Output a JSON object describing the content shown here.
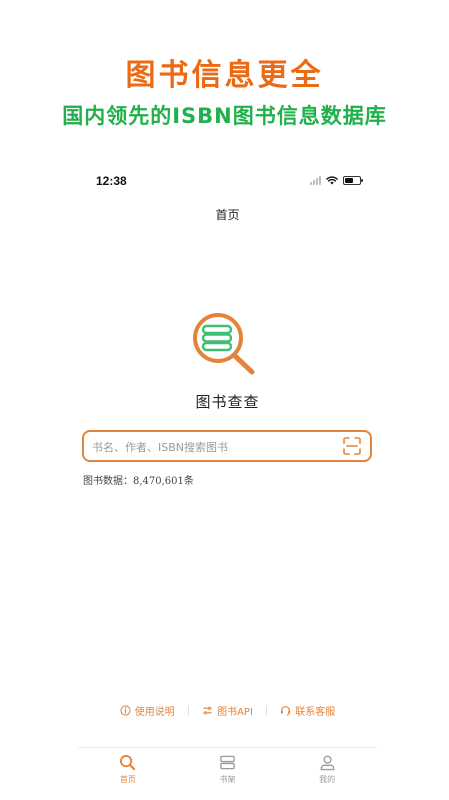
{
  "promo": {
    "title": "图书信息更全",
    "subtitle": "国内领先的ISBN图书信息数据库"
  },
  "status_bar": {
    "time": "12:38",
    "icons": [
      "signal-icon",
      "wifi-icon",
      "battery-icon"
    ]
  },
  "nav": {
    "title": "首页"
  },
  "app": {
    "name": "图书查查",
    "logo": "book-magnifier-icon"
  },
  "search": {
    "placeholder": "书名、作者、ISBN搜索图书",
    "scan_icon": "scan-icon"
  },
  "stats": {
    "label": "图书数据：",
    "count": "8,470,601条"
  },
  "footer_links": [
    {
      "label": "使用说明",
      "icon": "info-icon"
    },
    {
      "label": "图书API",
      "icon": "api-icon"
    },
    {
      "label": "联系客服",
      "icon": "headset-icon"
    }
  ],
  "footer_separator": "|",
  "tabs": [
    {
      "label": "首页",
      "icon": "search-icon",
      "active": true
    },
    {
      "label": "书架",
      "icon": "bookshelf-icon",
      "active": false
    },
    {
      "label": "我的",
      "icon": "user-icon",
      "active": false
    }
  ],
  "colors": {
    "accent": "#e4843a",
    "promo_title": "#ec6a14",
    "promo_subtitle": "#21b04b",
    "logo_green": "#3dbf72"
  }
}
